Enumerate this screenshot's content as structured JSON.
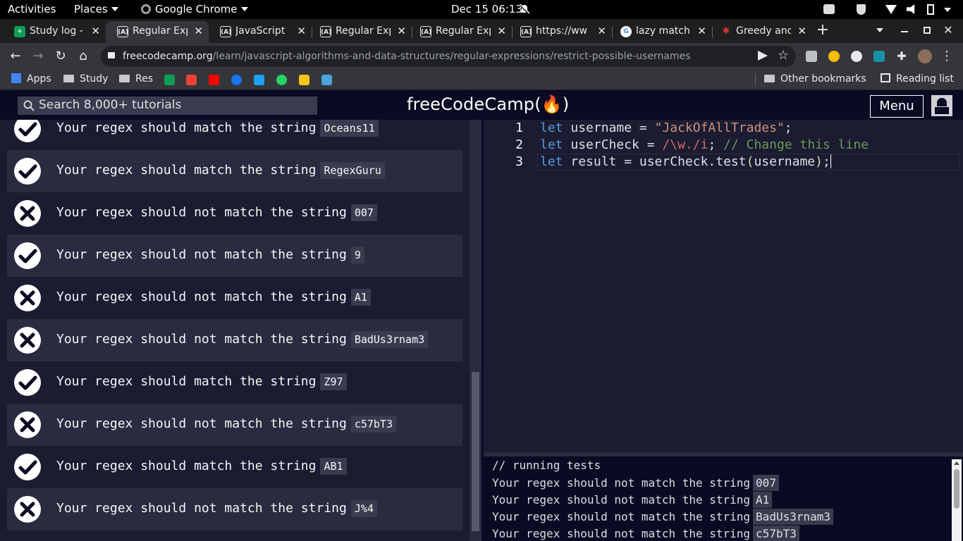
{
  "topbar": {
    "activities": "Activities",
    "places": "Places",
    "app": "Google Chrome",
    "clock": "Dec 15  06:13"
  },
  "tabs": [
    {
      "title": "Study log - G",
      "icon": "sheets-icon",
      "active": false
    },
    {
      "title": "Regular Exp",
      "icon": "fcc-icon",
      "active": true
    },
    {
      "title": "JavaScript",
      "icon": "fcc-icon",
      "active": false
    },
    {
      "title": "Regular Exp",
      "icon": "fcc-icon",
      "active": false
    },
    {
      "title": "Regular Exp",
      "icon": "fcc-icon",
      "active": false
    },
    {
      "title": "https://ww",
      "icon": "fcc-icon",
      "active": false
    },
    {
      "title": "lazy match",
      "icon": "google-icon",
      "active": false
    },
    {
      "title": "Greedy and",
      "icon": "app-icon",
      "active": false
    }
  ],
  "address": {
    "host": "freecodecamp.org",
    "path": "/learn/javascript-algorithms-and-data-structures/regular-expressions/restrict-possible-usernames"
  },
  "bookmarks": {
    "apps": "Apps",
    "study": "Study",
    "res": "Res",
    "other": "Other bookmarks",
    "reading": "Reading list"
  },
  "fcc": {
    "search_placeholder": "Search 8,000+ tutorials",
    "logo": "freeCodeCamp(🔥)",
    "menu": "Menu"
  },
  "tests": [
    {
      "status": "pass",
      "text": "Your regex should match the string",
      "code": "Oceans11"
    },
    {
      "status": "pass",
      "text": "Your regex should match the string",
      "code": "RegexGuru"
    },
    {
      "status": "fail",
      "text": "Your regex should not match the string",
      "code": "007"
    },
    {
      "status": "pass",
      "text": "Your regex should not match the string",
      "code": "9"
    },
    {
      "status": "fail",
      "text": "Your regex should not match the string",
      "code": "A1"
    },
    {
      "status": "fail",
      "text": "Your regex should not match the string",
      "code": "BadUs3rnam3"
    },
    {
      "status": "pass",
      "text": "Your regex should match the string",
      "code": "Z97"
    },
    {
      "status": "fail",
      "text": "Your regex should not match the string",
      "code": "c57bT3"
    },
    {
      "status": "pass",
      "text": "Your regex should match the string",
      "code": "AB1"
    },
    {
      "status": "fail",
      "text": "Your regex should not match the string",
      "code": "J%4"
    }
  ],
  "editor": {
    "line_numbers": [
      "1",
      "2",
      "3"
    ],
    "lines": [
      {
        "kw": "let",
        "name": " username = ",
        "str": "\"JackOfAllTrades\"",
        "end": ";"
      },
      {
        "kw": "let",
        "name": " userCheck = ",
        "rx": "/\\w./i",
        "end": "; ",
        "cm": "// Change this line"
      },
      {
        "kw": "let",
        "name": " result = userCheck.test",
        "p1": "(",
        "arg": "username",
        "p2": ")",
        "end": ";"
      }
    ]
  },
  "console": {
    "header": "// running tests",
    "lines": [
      {
        "text": "Your regex should not match the string",
        "code": "007"
      },
      {
        "text": "Your regex should not match the string",
        "code": "A1"
      },
      {
        "text": "Your regex should not match the string",
        "code": "BadUs3rnam3"
      },
      {
        "text": "Your regex should not match the string",
        "code": "c57bT3"
      }
    ]
  }
}
